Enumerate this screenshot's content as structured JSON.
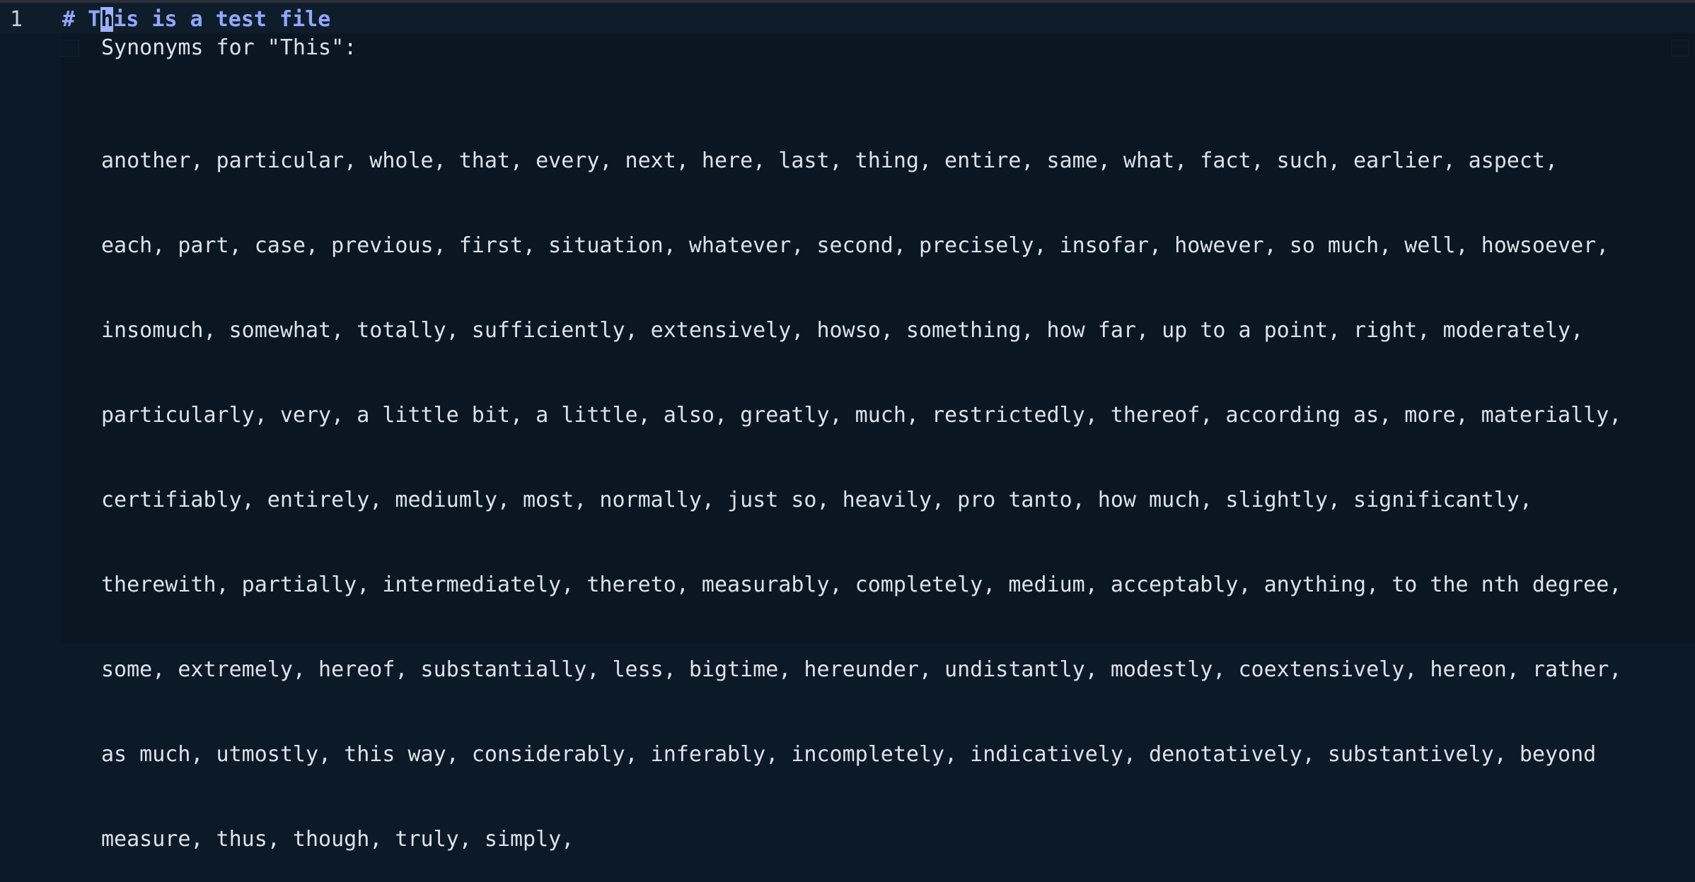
{
  "editor": {
    "line_number": "1",
    "heading_prefix": "# T",
    "cursor_char": "h",
    "heading_rest": "is is a test file"
  },
  "popup": {
    "title": "Synonyms for \"This\":",
    "lines": [
      "another, particular, whole, that, every, next, here, last, thing, entire, same, what, fact, such, earlier, aspect,",
      "each, part, case, previous, first, situation, whatever, second, precisely, insofar, however, so much, well, howsoever,",
      "insomuch, somewhat, totally, sufficiently, extensively, howso, something, how far, up to a point, right, moderately,",
      "particularly, very, a little bit, a little, also, greatly, much, restrictedly, thereof, according as, more, materially,",
      "certifiably, entirely, mediumly, most, normally, just so, heavily, pro tanto, how much, slightly, significantly,",
      "therewith, partially, intermediately, thereto, measurably, completely, medium, acceptably, anything, to the nth degree,",
      "some, extremely, hereof, substantially, less, bigtime, hereunder, undistantly, modestly, coextensively, hereon, rather,",
      "as much, utmostly, this way, considerably, inferably, incompletely, indicatively, denotatively, substantively, beyond",
      "measure, thus, though, truly, simply,"
    ]
  }
}
